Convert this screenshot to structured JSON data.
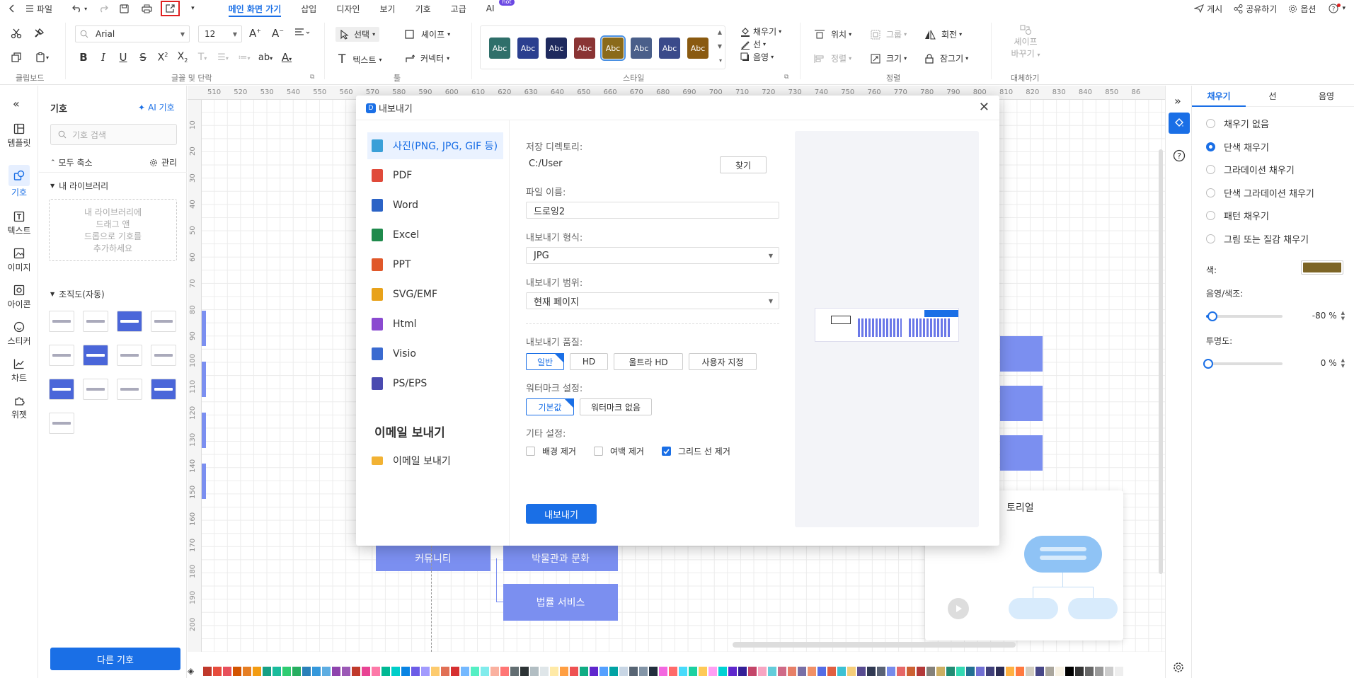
{
  "topbar": {
    "file_label": "파일",
    "tabs": [
      {
        "label": "메인 화면 가기",
        "active": true
      },
      {
        "label": "삽입"
      },
      {
        "label": "디자인"
      },
      {
        "label": "보기"
      },
      {
        "label": "기호"
      },
      {
        "label": "고급"
      },
      {
        "label": "AI",
        "badge": "hot"
      }
    ],
    "right": {
      "publish": "게시",
      "share": "공유하기",
      "options": "옵션"
    }
  },
  "ribbon": {
    "groups": {
      "clipboard": "클립보드",
      "font": "글꼴 및 단락",
      "tools": "툴",
      "style": "스타일",
      "arrange": "정렬",
      "replace": "대체하기"
    },
    "font_name": "Arial",
    "font_size": "12",
    "select": "선택",
    "shape": "셰이프",
    "text": "텍스트",
    "connector": "커넥터",
    "fill": "채우기",
    "line": "선",
    "shadow": "음영",
    "position": "위치",
    "group": "그룹",
    "rotate": "회전",
    "align": "정렬",
    "size": "크기",
    "lock": "잠그기",
    "replace_shape_1": "셰이프",
    "replace_shape_2": "바꾸기",
    "style_swatch_text": "Abc",
    "style_colors": [
      "#2f6f6a",
      "#2b3f8f",
      "#1f2a5e",
      "#8a3434",
      "#8a6a1a",
      "#4a5f8a",
      "#3a4a8a",
      "#8a5a10"
    ]
  },
  "leftnav": [
    {
      "label": "템플릿",
      "icon": "template-icon"
    },
    {
      "label": "기호",
      "icon": "symbol-icon",
      "active": true
    },
    {
      "label": "텍스트",
      "icon": "text-icon"
    },
    {
      "label": "이미지",
      "icon": "image-icon"
    },
    {
      "label": "아이콘",
      "icon": "icon-icon"
    },
    {
      "label": "스티커",
      "icon": "sticker-icon"
    },
    {
      "label": "차트",
      "icon": "chart-icon"
    },
    {
      "label": "위젯",
      "icon": "widget-icon"
    }
  ],
  "symbols": {
    "title": "기호",
    "ai_symbol": "AI 기호",
    "search_placeholder": "기호 검색",
    "collapse_all": "모두 축소",
    "manage": "관리",
    "my_library": "내 라이브러리",
    "my_library_hint": "내 라이브러리에\n드래그 앤\n드롭으로 기호를\n추가하세요",
    "org_chart": "조직도(자동)",
    "more_symbols": "다른 기호"
  },
  "canvas": {
    "ruler_h": [
      "510",
      "520",
      "530",
      "540",
      "550",
      "560",
      "570",
      "580",
      "590",
      "600",
      "610",
      "620",
      "630",
      "640",
      "650",
      "660",
      "670",
      "680",
      "690",
      "700",
      "710",
      "720",
      "730",
      "740",
      "750",
      "760",
      "770",
      "780",
      "790",
      "800",
      "810",
      "820",
      "830",
      "840",
      "850",
      "86"
    ],
    "ruler_v": [
      "10",
      "20",
      "30",
      "40",
      "50",
      "60",
      "70",
      "80",
      "90",
      "100",
      "110",
      "120",
      "130",
      "140",
      "150",
      "160",
      "170",
      "180",
      "190",
      "200"
    ],
    "shape_community": "커뮤니티",
    "shape_museum": "박물관과 문화",
    "shape_legal": "법률 서비스",
    "tutorial_title": "튜토리얼",
    "tutorial_partial": "토리얼"
  },
  "rightpanel": {
    "tabs": [
      "채우기",
      "선",
      "음영"
    ],
    "fill_options": [
      "채우기 없음",
      "단색 채우기",
      "그라데이션 채우기",
      "단색 그라데이션 채우기",
      "패턴 채우기",
      "그림 또는 질감 채우기"
    ],
    "selected_fill": 1,
    "color_label": "색:",
    "color_value": "#7d6526",
    "shade_label": "음영/색조:",
    "shade_value": "-80 %",
    "shade_fraction": 0.02,
    "opacity_label": "투명도:",
    "opacity_value": "0 %",
    "opacity_fraction": 0.0
  },
  "dialog": {
    "title": "내보내기",
    "formats": [
      {
        "label": "사진(PNG, JPG, GIF 등)",
        "color": "#3aa0d8",
        "icon": "image-file-icon",
        "selected": true
      },
      {
        "label": "PDF",
        "color": "#e04a3a",
        "icon": "pdf-file-icon"
      },
      {
        "label": "Word",
        "color": "#2b63c6",
        "icon": "word-file-icon"
      },
      {
        "label": "Excel",
        "color": "#1f8a4c",
        "icon": "excel-file-icon"
      },
      {
        "label": "PPT",
        "color": "#e0582a",
        "icon": "ppt-file-icon"
      },
      {
        "label": "SVG/EMF",
        "color": "#e8a21a",
        "icon": "svg-file-icon"
      },
      {
        "label": "Html",
        "color": "#8a4ad0",
        "icon": "html-file-icon"
      },
      {
        "label": "Visio",
        "color": "#3a6ad0",
        "icon": "visio-file-icon"
      },
      {
        "label": "PS/EPS",
        "color": "#4a4ab0",
        "icon": "ps-file-icon"
      }
    ],
    "email_heading": "이메일 보내기",
    "email_item": "이메일 보내기",
    "save_dir_label": "저장 디렉토리:",
    "save_dir_value": "C:/User",
    "browse": "찾기",
    "filename_label": "파일 이름:",
    "filename_value": "드로잉2",
    "format_label": "내보내기 형식:",
    "format_value": "JPG",
    "range_label": "내보내기 범위:",
    "range_value": "현재 페이지",
    "quality_label": "내보내기 품질:",
    "quality_options": [
      "일반",
      "HD",
      "울트라 HD",
      "사용자 지정"
    ],
    "quality_selected": 0,
    "watermark_label": "워터마크 설정:",
    "watermark_options": [
      "기본값",
      "워터마크 없음"
    ],
    "watermark_selected": 0,
    "other_label": "기타 설정:",
    "other_options": [
      {
        "label": "배경 제거",
        "checked": false
      },
      {
        "label": "여백 제거",
        "checked": false
      },
      {
        "label": "그리드 선 제거",
        "checked": true
      }
    ],
    "export_button": "내보내기"
  },
  "palette": [
    "#c0392b",
    "#e74c3c",
    "#e8505b",
    "#d35400",
    "#e67e22",
    "#f39c12",
    "#16a085",
    "#1abc9c",
    "#2ecc71",
    "#27ae60",
    "#2980b9",
    "#3498db",
    "#5dade2",
    "#8e44ad",
    "#9b59b6",
    "#c0392b",
    "#e84393",
    "#fd79a8",
    "#00b894",
    "#00cec9",
    "#0984e3",
    "#6c5ce7",
    "#a29bfe",
    "#fdcb6e",
    "#e17055",
    "#d63031",
    "#74b9ff",
    "#55efc4",
    "#81ecec",
    "#fab1a0",
    "#ff7675",
    "#636e72",
    "#2d3436",
    "#b2bec3",
    "#dfe6e9",
    "#ffeaa7",
    "#ff9f43",
    "#ee5253",
    "#10ac84",
    "#5f27cd",
    "#54a0ff",
    "#01a3a4",
    "#c8d6e5",
    "#576574",
    "#8395a7",
    "#222f3e",
    "#f368e0",
    "#ff6b6b",
    "#48dbfb",
    "#1dd1a1",
    "#feca57",
    "#ff9ff3",
    "#00d2d3",
    "#5f27cd",
    "#341f97",
    "#c44569",
    "#f8a5c2",
    "#63cdda",
    "#cf6a87",
    "#e77f67",
    "#786fa6",
    "#f19066",
    "#546de5",
    "#e15f41",
    "#3dc1d3",
    "#f5cd79",
    "#574b90",
    "#303952",
    "#596275",
    "#778beb",
    "#e66767",
    "#cd6133",
    "#b33939",
    "#84817a",
    "#ccae62",
    "#218c74",
    "#33d9b2",
    "#227093",
    "#706fd3",
    "#40407a",
    "#2c2c54",
    "#ffb142",
    "#ff793f",
    "#d1ccc0",
    "#474787",
    "#aaa69d",
    "#f7f1e3",
    "#000000",
    "#333333",
    "#666666",
    "#999999",
    "#cccccc",
    "#eeeeee"
  ]
}
